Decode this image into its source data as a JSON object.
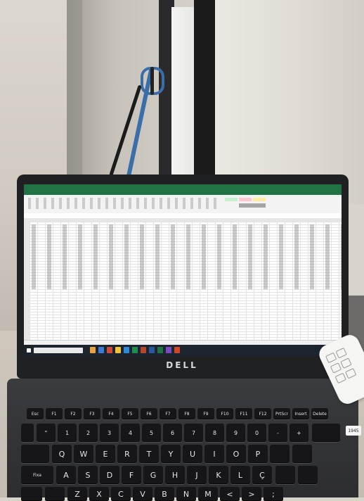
{
  "photo": {
    "subject": "laptop",
    "brand_logo": "DELL",
    "screen_app": "spreadsheet",
    "accent_color": "#217346",
    "sticker_text": "1945"
  },
  "keyboard": {
    "fn_row": [
      "Esc",
      "F1",
      "F2",
      "F3",
      "F4",
      "F5",
      "F6",
      "F7",
      "F8",
      "F9",
      "F10",
      "F11",
      "F12",
      "PrtScr",
      "Insert",
      "Delete"
    ],
    "num_row": [
      "\"",
      "1",
      "2",
      "3",
      "4",
      "5",
      "6",
      "7",
      "8",
      "9",
      "0",
      "-",
      "+"
    ],
    "top_row": [
      "Q",
      "W",
      "E",
      "R",
      "T",
      "Y",
      "U",
      "I",
      "O",
      "P"
    ],
    "home_row": [
      "A",
      "S",
      "D",
      "F",
      "G",
      "H",
      "J",
      "K",
      "L",
      "Ç"
    ],
    "bottom_row": [
      "Z",
      "X",
      "C",
      "V",
      "B",
      "N",
      "M",
      "<",
      ">",
      ";"
    ],
    "caps_label": "Fixa"
  }
}
